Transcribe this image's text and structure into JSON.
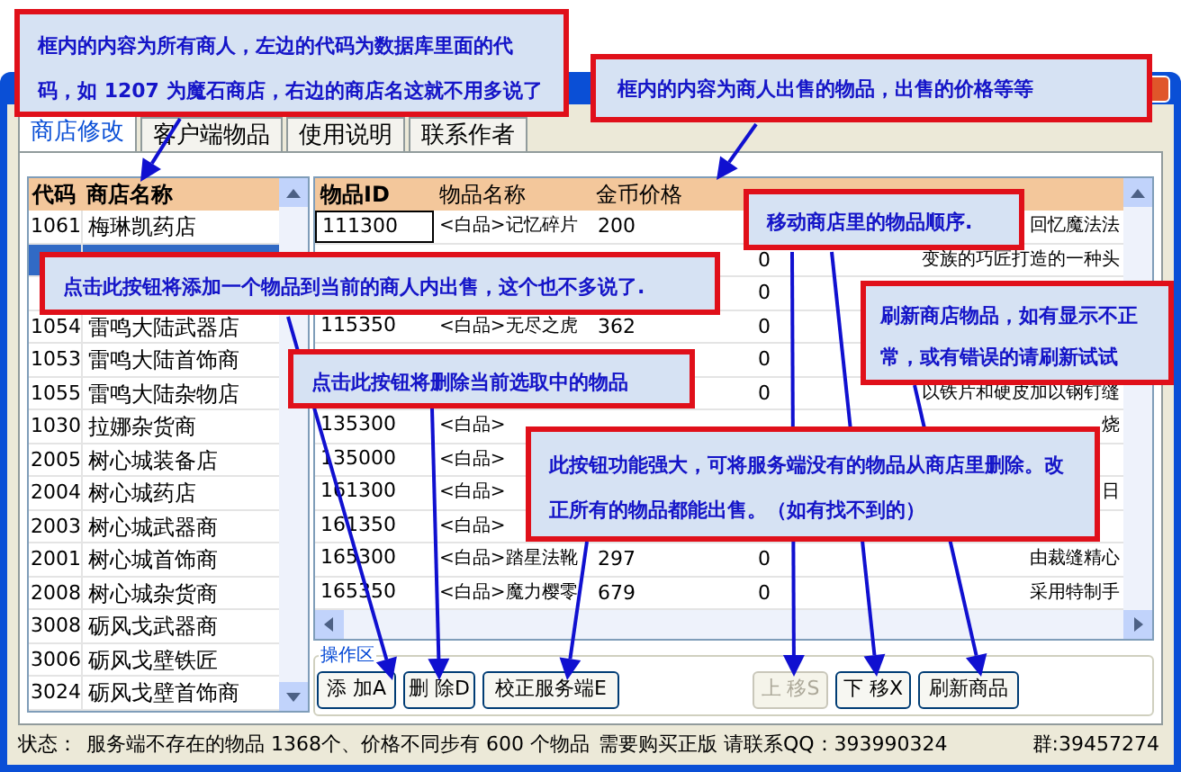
{
  "tabs": [
    {
      "label": "商店修改",
      "selected": true
    },
    {
      "label": "客户端物品",
      "selected": false
    },
    {
      "label": "使用说明",
      "selected": false
    },
    {
      "label": "联系作者",
      "selected": false
    }
  ],
  "shop_table": {
    "columns": [
      "代码",
      "商店名称"
    ],
    "rows": [
      {
        "code": "1061",
        "name": "梅琳凯药店",
        "selected": false
      },
      {
        "selected": true
      },
      {
        "selected": false
      },
      {
        "code": "1054",
        "name": "雷鸣大陆武器店",
        "selected": false
      },
      {
        "code": "1053",
        "name": "雷鸣大陆首饰商",
        "selected": false
      },
      {
        "code": "1055",
        "name": "雷鸣大陆杂物店",
        "selected": false
      },
      {
        "code": "1030",
        "name": "拉娜杂货商",
        "selected": false
      },
      {
        "code": "2005",
        "name": "树心城装备店",
        "selected": false
      },
      {
        "code": "2004",
        "name": "树心城药店",
        "selected": false
      },
      {
        "code": "2003",
        "name": "树心城武器商",
        "selected": false
      },
      {
        "code": "2001",
        "name": "树心城首饰商",
        "selected": false
      },
      {
        "code": "2008",
        "name": "树心城杂货商",
        "selected": false
      },
      {
        "code": "3008",
        "name": "砺风戈武器商",
        "selected": false
      },
      {
        "code": "3006",
        "name": "砺风戈壁铁匠",
        "selected": false
      },
      {
        "code": "3024",
        "name": "砺风戈壁首饰商",
        "selected": false
      }
    ]
  },
  "item_table": {
    "columns": [
      "物品ID",
      "物品名称",
      "金币价格"
    ],
    "rows": [
      {
        "id": "111300",
        "name": "<白品>记忆碎片",
        "price": "200",
        "column_5": "回忆魔法法"
      },
      {
        "column_4": "0",
        "column_5": "变族的巧匠打造的一种头"
      },
      {
        "column_4": "0"
      },
      {
        "id": "115350",
        "name": "<白品>无尽之虎",
        "price": "362",
        "column_4": "0"
      },
      {
        "column_4": "0"
      },
      {
        "column_4": "0",
        "column_5": "以铁片和硬皮加以钢钉缝"
      },
      {
        "id": "135300",
        "name": "<白品>",
        "column_5": "烧"
      },
      {
        "id": "135000",
        "name": "<白品>"
      },
      {
        "id": "161300",
        "name": "<白品>",
        "column_5": "日"
      },
      {
        "id": "161350",
        "name": "<白品>"
      },
      {
        "id": "165300",
        "name": "<白品>踏星法靴",
        "price": "297",
        "column_4": "0",
        "column_5": "由裁缝精心"
      },
      {
        "id": "165350",
        "name": "<白品>魔力樱零",
        "price": "679",
        "column_4": "0",
        "column_5": "采用特制手"
      }
    ]
  },
  "operation_area": {
    "title": "操作区",
    "buttons": [
      {
        "label": "添 加A",
        "disabled": false
      },
      {
        "label": "删 除D",
        "disabled": false
      },
      {
        "label": "校正服务端E",
        "disabled": false
      },
      {
        "label": "上 移S",
        "disabled": true
      },
      {
        "label": "下 移X",
        "disabled": false
      },
      {
        "label": "刷新商品",
        "disabled": false
      }
    ]
  },
  "status_bar": {
    "label": "状态：",
    "message": "服务端不存在的物品 1368个、价格不同步有 600 个物品",
    "notice": "需要购买正版 请联系QQ：393990324",
    "group": "群:39457274"
  },
  "callouts": [
    {
      "text": "框内的内容为所有商人，左边的代码为数据库里面的代码，如 1207 为魔石商店，右边的商店名这就不用多说了"
    },
    {
      "text": "框内的内容为商人出售的物品，出售的价格等等"
    },
    {
      "text": "移动商店里的物品顺序."
    },
    {
      "text": "点击此按钮将添加一个物品到当前的商人内出售，这个也不多说了."
    },
    {
      "text": "刷新商店物品，如有显示不正常，或有错误的请刷新试试"
    },
    {
      "text": "点击此按钮将删除当前选取中的物品"
    },
    {
      "text": "此按钮功能强大，可将服务端没有的物品从商店里删除。改正所有的物品都能出售。（如有找不到的）"
    }
  ]
}
